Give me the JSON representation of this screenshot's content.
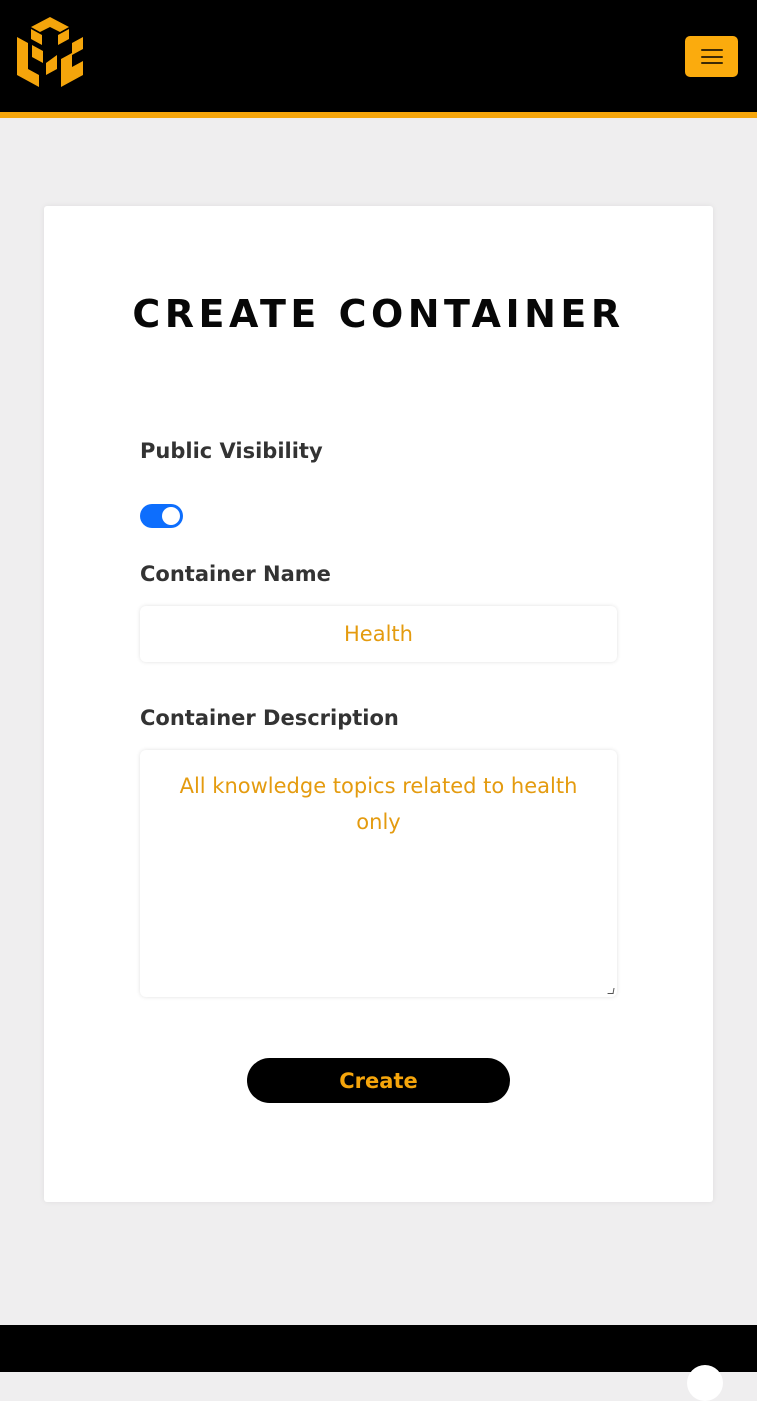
{
  "header": {
    "logo_icon": "ccg-cube-logo-icon",
    "menu_icon": "hamburger-menu-icon",
    "accent_color": "#f5a50b"
  },
  "form": {
    "title": "CREATE CONTAINER",
    "visibility_label": "Public Visibility",
    "visibility_on": true,
    "name_label": "Container Name",
    "name_value": "Health",
    "description_label": "Container Description",
    "description_value": "All knowledge topics related to health only",
    "submit_label": "Create"
  },
  "footer": {
    "icon": "circle-icon"
  }
}
